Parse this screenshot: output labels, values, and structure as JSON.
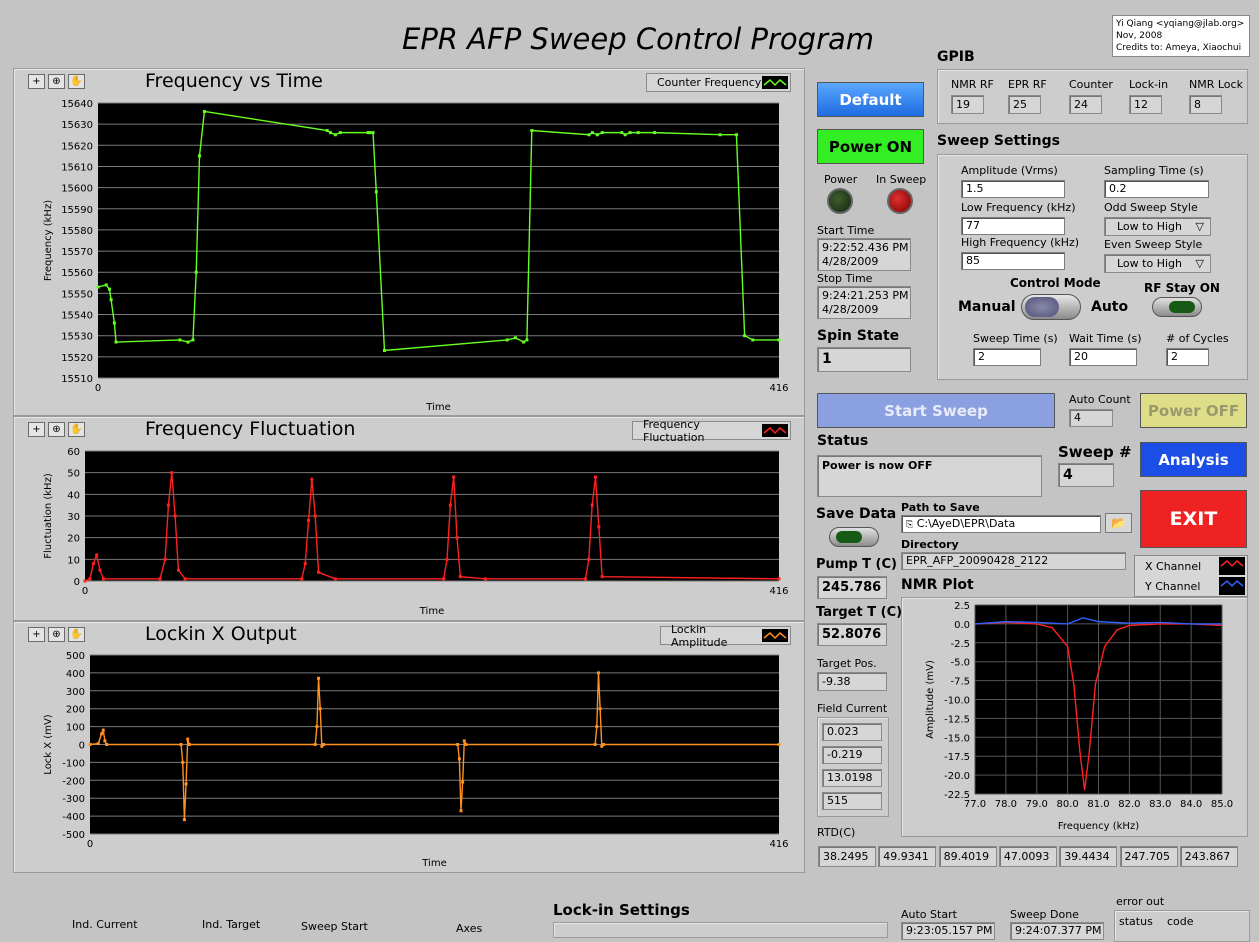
{
  "app_title": "EPR AFP Sweep Control Program",
  "credits": {
    "line1": "Yi Qiang <yqiang@jlab.org>",
    "line2": "Nov, 2008",
    "line3": "Credits to: Ameya, Xiaochui"
  },
  "charts": {
    "freq": {
      "title": "Frequency vs Time",
      "legend": "Counter Frequency",
      "ylabel": "Frequency (kHz)",
      "xlabel": "Time",
      "yticks": [
        "15640",
        "15630",
        "15620",
        "15610",
        "15600",
        "15590",
        "15580",
        "15570",
        "15560",
        "15550",
        "15540",
        "15530",
        "15520",
        "15510"
      ],
      "xmin": "0",
      "xmax": "416"
    },
    "fluct": {
      "title": "Frequency Fluctuation",
      "legend": "Frequency Fluctuation",
      "ylabel": "Fluctuation (kHz)",
      "xlabel": "Time",
      "yticks": [
        "60",
        "50",
        "40",
        "30",
        "20",
        "10",
        "0"
      ],
      "xmin": "0",
      "xmax": "416"
    },
    "lockin": {
      "title": "Lockin X Output",
      "legend": "Lockin Amplitude",
      "ylabel": "Lock X (mV)",
      "xlabel": "Time",
      "yticks": [
        "500",
        "400",
        "300",
        "200",
        "100",
        "0",
        "-100",
        "-200",
        "-300",
        "-400",
        "-500"
      ],
      "xmin": "0",
      "xmax": "416"
    },
    "nmr": {
      "title": "NMR Plot",
      "ylabel": "Amplitude (mV)",
      "xlabel": "Frequency (kHz)",
      "yticks": [
        "2.5",
        "0.0",
        "-2.5",
        "-5.0",
        "-7.5",
        "-10.0",
        "-12.5",
        "-15.0",
        "-17.5",
        "-20.0",
        "-22.5"
      ],
      "xticks": [
        "77.0",
        "78.0",
        "79.0",
        "80.0",
        "81.0",
        "82.0",
        "83.0",
        "84.0",
        "85.0"
      ],
      "legend_x": "X Channel",
      "legend_y": "Y Channel"
    }
  },
  "chart_data": [
    {
      "type": "line",
      "title": "Frequency vs Time",
      "xlabel": "Time",
      "ylabel": "Frequency (kHz)",
      "xlim": [
        0,
        416
      ],
      "ylim": [
        15510,
        15640
      ],
      "series": [
        {
          "name": "Counter Frequency",
          "color": "#66ff22",
          "x": [
            0,
            5,
            7,
            8,
            10,
            11,
            50,
            55,
            58,
            60,
            62,
            65,
            140,
            142,
            145,
            148,
            165,
            166,
            168,
            170,
            175,
            250,
            255,
            260,
            262,
            265,
            300,
            302,
            305,
            308,
            320,
            322,
            325,
            330,
            340,
            380,
            390,
            395,
            400,
            416
          ],
          "y": [
            15553,
            15554,
            15552,
            15547,
            15536,
            15527,
            15528,
            15527,
            15528,
            15560,
            15615,
            15636,
            15627,
            15626,
            15625,
            15626,
            15626,
            15626,
            15626,
            15598,
            15523,
            15528,
            15529,
            15527,
            15528,
            15627,
            15625,
            15626,
            15625,
            15626,
            15626,
            15625,
            15626,
            15626,
            15626,
            15625,
            15625,
            15530,
            15528,
            15528
          ]
        }
      ]
    },
    {
      "type": "line",
      "title": "Frequency Fluctuation",
      "xlabel": "Time",
      "ylabel": "Fluctuation (kHz)",
      "xlim": [
        0,
        416
      ],
      "ylim": [
        0,
        60
      ],
      "series": [
        {
          "name": "Frequency Fluctuation",
          "color": "#ff2020",
          "x": [
            0,
            3,
            5,
            7,
            9,
            11,
            45,
            48,
            50,
            52,
            54,
            56,
            60,
            130,
            132,
            134,
            136,
            138,
            140,
            150,
            215,
            217,
            219,
            221,
            223,
            225,
            240,
            300,
            302,
            304,
            306,
            308,
            310,
            416
          ],
          "y": [
            0,
            1,
            8,
            12,
            5,
            1,
            1,
            10,
            35,
            50,
            30,
            5,
            1,
            1,
            8,
            28,
            47,
            30,
            4,
            1,
            1,
            10,
            35,
            48,
            20,
            2,
            1,
            1,
            10,
            35,
            48,
            25,
            2,
            1
          ]
        }
      ]
    },
    {
      "type": "line",
      "title": "Lockin X Output",
      "xlabel": "Time",
      "ylabel": "Lock X (mV)",
      "xlim": [
        0,
        416
      ],
      "ylim": [
        -500,
        500
      ],
      "series": [
        {
          "name": "Lockin Amplitude",
          "color": "#ff9020",
          "x": [
            0,
            5,
            7,
            8,
            9,
            10,
            55,
            56,
            57,
            58,
            59,
            60,
            136,
            137,
            138,
            139,
            140,
            141,
            222,
            223,
            224,
            225,
            226,
            227,
            305,
            306,
            307,
            308,
            309,
            310,
            416
          ],
          "y": [
            0,
            5,
            60,
            80,
            20,
            0,
            0,
            -100,
            -420,
            -220,
            30,
            0,
            0,
            100,
            370,
            200,
            -10,
            0,
            0,
            -80,
            -370,
            -210,
            20,
            0,
            0,
            100,
            400,
            200,
            -10,
            0,
            0
          ]
        }
      ]
    },
    {
      "type": "line",
      "title": "NMR Plot",
      "xlabel": "Frequency (kHz)",
      "ylabel": "Amplitude (mV)",
      "xlim": [
        77,
        85
      ],
      "ylim": [
        -22.5,
        2.5
      ],
      "series": [
        {
          "name": "X Channel",
          "color": "#ff2020",
          "x": [
            77,
            78,
            79,
            79.5,
            80,
            80.2,
            80.4,
            80.55,
            80.7,
            80.9,
            81.2,
            81.6,
            82,
            83,
            84,
            85
          ],
          "y": [
            0,
            0.2,
            0,
            -0.5,
            -3,
            -8,
            -17,
            -22,
            -17,
            -8,
            -3,
            -0.8,
            -0.2,
            0,
            0,
            -0.2
          ]
        },
        {
          "name": "Y Channel",
          "color": "#3060ff",
          "x": [
            77,
            78,
            79,
            80,
            80.5,
            81,
            82,
            83,
            84,
            85
          ],
          "y": [
            0,
            0.3,
            0.2,
            0,
            0.8,
            0.3,
            0.1,
            0.2,
            0,
            0
          ]
        }
      ]
    }
  ],
  "buttons": {
    "default": "Default",
    "power_on": "Power ON",
    "start_sweep": "Start Sweep",
    "power_off": "Power OFF",
    "analysis": "Analysis",
    "exit": "EXIT"
  },
  "leds": {
    "power": "Power",
    "in_sweep": "In Sweep"
  },
  "times": {
    "start_label": "Start Time",
    "start_time": "9:22:52.436 PM",
    "start_date": "4/28/2009",
    "stop_label": "Stop Time",
    "stop_time": "9:24:21.253 PM",
    "stop_date": "4/28/2009"
  },
  "spin": {
    "label": "Spin State",
    "value": "1"
  },
  "gpib": {
    "title": "GPIB",
    "fields": [
      {
        "label": "NMR RF",
        "value": "19"
      },
      {
        "label": "EPR RF",
        "value": "25"
      },
      {
        "label": "Counter",
        "value": "24"
      },
      {
        "label": "Lock-in",
        "value": "12"
      },
      {
        "label": "NMR Lock",
        "value": "8"
      }
    ]
  },
  "sweep": {
    "title": "Sweep Settings",
    "amplitude_label": "Amplitude (Vrms)",
    "amplitude": "1.5",
    "sampling_label": "Sampling Time (s)",
    "sampling": "0.2",
    "low_label": "Low Frequency (kHz)",
    "low": "77",
    "odd_label": "Odd Sweep Style",
    "odd": "Low to High",
    "high_label": "High Frequency (kHz)",
    "high": "85",
    "even_label": "Even Sweep Style",
    "even": "Low to High",
    "control_label": "Control Mode",
    "manual": "Manual",
    "auto": "Auto",
    "rf_stay": "RF Stay ON",
    "sweep_time_label": "Sweep Time (s)",
    "sweep_time": "2",
    "wait_label": "Wait Time (s)",
    "wait": "20",
    "cycles_label": "# of Cycles",
    "cycles": "2"
  },
  "auto_count": {
    "label": "Auto Count",
    "value": "4"
  },
  "status": {
    "label": "Status",
    "value": "Power is now OFF"
  },
  "sweep_num": {
    "label": "Sweep #",
    "value": "4"
  },
  "save": {
    "label": "Save Data",
    "path_label": "Path to Save",
    "path": "C:\\AyeD\\EPR\\Data",
    "dir_label": "Directory",
    "dir": "EPR_AFP_20090428_2122"
  },
  "pump": {
    "label": "Pump T (C)",
    "value": "245.786"
  },
  "target": {
    "label": "Target T (C)",
    "value": "52.8076"
  },
  "target_pos": {
    "label": "Target Pos.",
    "value": "-9.38"
  },
  "field_current": {
    "label": "Field Current",
    "values": [
      "0.023",
      "-0.219",
      "13.0198",
      "515"
    ]
  },
  "rtd": {
    "label": "RTD(C)",
    "values": [
      "38.2495",
      "49.9341",
      "89.4019",
      "47.0093",
      "39.4434",
      "247.705",
      "243.867"
    ]
  },
  "bottom": {
    "ind_current": "Ind. Current",
    "ind_target": "Ind. Target",
    "sweep_start": "Sweep Start",
    "axes": "Axes",
    "lockin_settings": "Lock-in Settings",
    "auto_start": "Auto Start",
    "auto_start_val": "9:23:05.157 PM",
    "sweep_done": "Sweep Done",
    "sweep_done_val": "9:24:07.377 PM",
    "error_out": "error out",
    "status": "status",
    "code": "code"
  }
}
